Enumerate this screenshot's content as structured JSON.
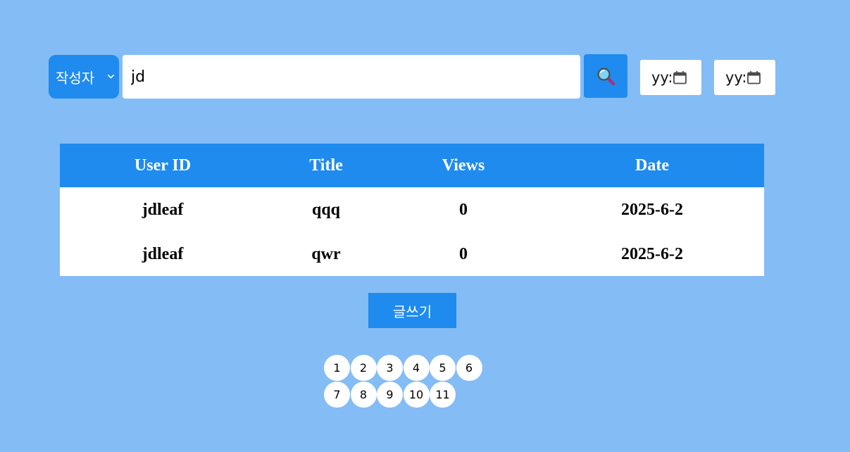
{
  "search": {
    "filter_label": "작성자",
    "query_value": "jd",
    "date_from_text": "yy:",
    "date_to_text": "yy:"
  },
  "table": {
    "headers": [
      "User ID",
      "Title",
      "Views",
      "Date"
    ],
    "rows": [
      [
        "jdleaf",
        "qqq",
        "0",
        "2025-6-2"
      ],
      [
        "jdleaf",
        "qwr",
        "0",
        "2025-6-2"
      ]
    ]
  },
  "write_button_label": "글쓰기",
  "pagination": {
    "pages": [
      "1",
      "2",
      "3",
      "4",
      "5",
      "6",
      "7",
      "8",
      "9",
      "10",
      "11"
    ]
  },
  "colors": {
    "background": "#84bcf5",
    "accent": "#1f8bef",
    "surface": "#ffffff"
  },
  "icons": {
    "filter_chevron": "chevron-down-icon",
    "search": "magnifier-icon",
    "calendar": "calendar-icon"
  }
}
